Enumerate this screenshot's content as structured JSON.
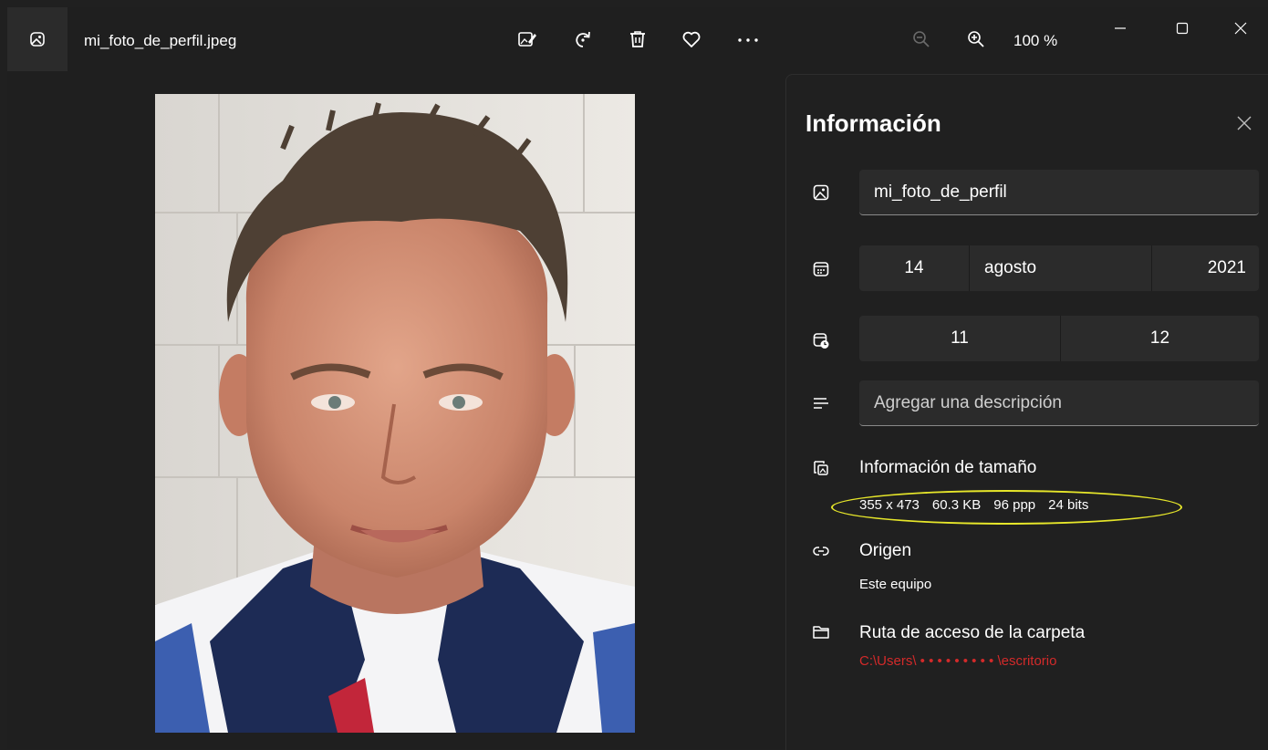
{
  "window": {
    "filename": "mi_foto_de_perfil.jpeg",
    "zoom_label": "100 %"
  },
  "toolbar": {
    "icons": [
      "edit-image-icon",
      "rotate-icon",
      "delete-icon",
      "favorite-icon",
      "more-icon",
      "zoom-out-icon",
      "zoom-in-icon"
    ]
  },
  "photo": {
    "subject": "portrait"
  },
  "info_panel": {
    "title": "Información",
    "name_field": "mi_foto_de_perfil",
    "date": {
      "day": "14",
      "month": "agosto",
      "year": "2021"
    },
    "time": {
      "hour": "11",
      "minute": "12"
    },
    "description_placeholder": "Agregar una descripción",
    "size": {
      "heading": "Información de tamaño",
      "dimensions": "355 x 473",
      "file_size": "60.3 KB",
      "dpi": "96 ppp",
      "bit_depth": "24 bits",
      "highlight_color": "#e6e62a"
    },
    "origin": {
      "heading": "Origen",
      "value": "Este equipo"
    },
    "folder": {
      "heading": "Ruta de acceso de la carpeta",
      "path": "C:\\Users\\ • • • • • • • • • \\escritorio",
      "path_color": "#d32a2a"
    }
  }
}
